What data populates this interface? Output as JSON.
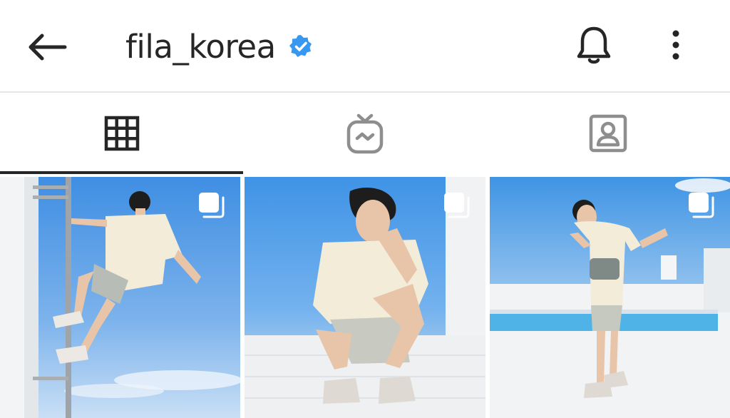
{
  "header": {
    "username": "fila_korea",
    "verified": true,
    "icons": [
      "back-arrow-icon",
      "verified-badge-icon",
      "bell-icon",
      "more-vertical-icon"
    ]
  },
  "tabs": [
    {
      "name": "posts-grid",
      "icon": "grid-icon",
      "active": true
    },
    {
      "name": "igtv",
      "icon": "igtv-icon",
      "active": false
    },
    {
      "name": "tagged",
      "icon": "tagged-icon",
      "active": false
    }
  ],
  "posts": [
    {
      "type": "carousel",
      "icon": "multiple-photos-icon"
    },
    {
      "type": "carousel",
      "icon": "multiple-photos-icon"
    },
    {
      "type": "carousel",
      "icon": "multiple-photos-icon"
    }
  ],
  "colors": {
    "text": "#262626",
    "verified": "#3897f0",
    "divider": "#e6e6e6",
    "inactive_icon": "#8e8e8e"
  }
}
